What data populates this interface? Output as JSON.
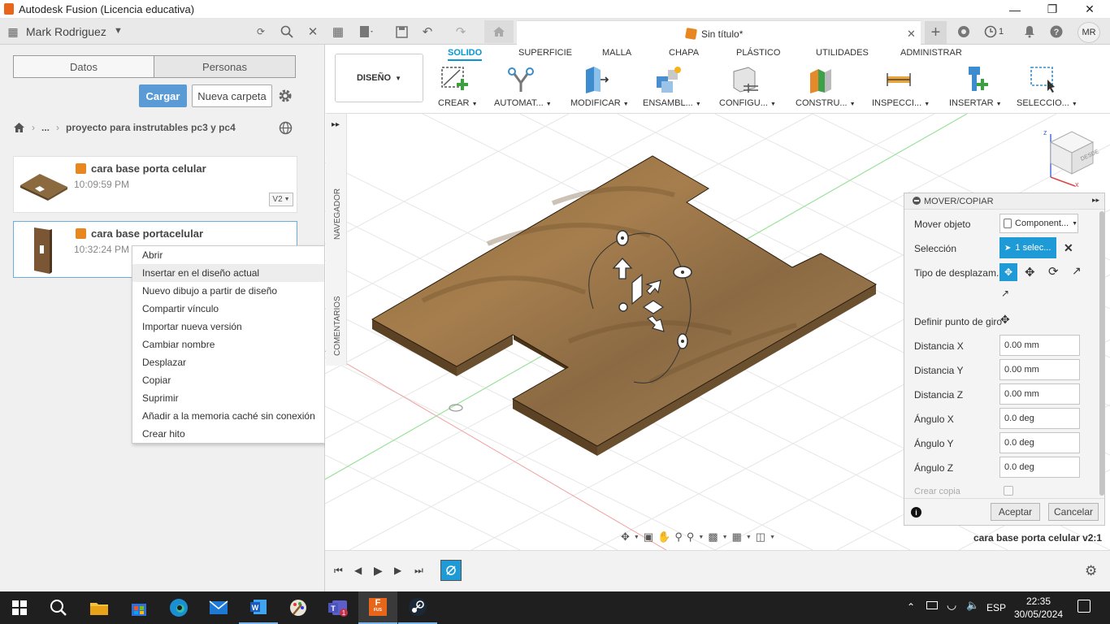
{
  "window": {
    "title": "Autodesk Fusion (Licencia educativa)"
  },
  "toolbar": {
    "user": "Mark Rodriguez",
    "doc_title": "Sin título*",
    "notif_count": "1",
    "avatar": "MR"
  },
  "panel": {
    "tab_datos": "Datos",
    "tab_personas": "Personas",
    "upload": "Cargar",
    "new_folder": "Nueva carpeta",
    "breadcrumb_ellipsis": "...",
    "breadcrumb_project": "proyecto para instrutables pc3 y pc4",
    "files": [
      {
        "title": "cara base porta celular",
        "time": "10:09:59 PM",
        "version": "V2"
      },
      {
        "title": "cara base portacelular",
        "time": "10:32:24 PM"
      }
    ]
  },
  "context_menu": [
    "Abrir",
    "Insertar en el diseño actual",
    "Nuevo dibujo a partir de diseño",
    "Compartir vínculo",
    "Importar nueva versión",
    "Cambiar nombre",
    "Desplazar",
    "Copiar",
    "Suprimir",
    "Añadir a la memoria caché sin conexión",
    "Crear hito"
  ],
  "ribbon": {
    "workspace": "DISEÑO",
    "tabs": [
      "SOLIDO",
      "SUPERFICIE",
      "MALLA",
      "CHAPA",
      "PLÁSTICO",
      "UTILIDADES",
      "ADMINISTRAR"
    ],
    "groups": [
      "CREAR",
      "AUTOMAT...",
      "MODIFICAR",
      "ENSAMBL...",
      "CONFIGU...",
      "CONSTRU...",
      "INSPECCI...",
      "INSERTAR",
      "SELECCIO..."
    ]
  },
  "viewport": {
    "nav_label": "NAVEGADOR",
    "comments_label": "COMENTARIOS",
    "viewcube_face": "DESDE",
    "status": "cara base porta celular v2:1"
  },
  "dialog": {
    "title": "MOVER/COPIAR",
    "move_object_label": "Mover objeto",
    "move_object_value": "Component...",
    "selection_label": "Selección",
    "selection_value": "1 selec...",
    "move_type_label": "Tipo de desplazam...",
    "pivot_label": "Definir punto de giro",
    "fields": [
      {
        "label": "Distancia X",
        "value": "0.00 mm"
      },
      {
        "label": "Distancia Y",
        "value": "0.00 mm"
      },
      {
        "label": "Distancia Z",
        "value": "0.00 mm"
      },
      {
        "label": "Ángulo X",
        "value": "0.0 deg"
      },
      {
        "label": "Ángulo Y",
        "value": "0.0 deg"
      },
      {
        "label": "Ángulo Z",
        "value": "0.0 deg"
      }
    ],
    "create_copy_label": "Crear copia",
    "ok": "Aceptar",
    "cancel": "Cancelar"
  },
  "taskbar": {
    "lang": "ESP",
    "time": "22:35",
    "date": "30/05/2024",
    "teams_badge": "1",
    "fusion_label": "FUS"
  },
  "colors": {
    "accent": "#0696d7",
    "upload_button": "#5a9bd5",
    "selection_blue": "#1e9ad6",
    "wood": "#9a7348"
  }
}
